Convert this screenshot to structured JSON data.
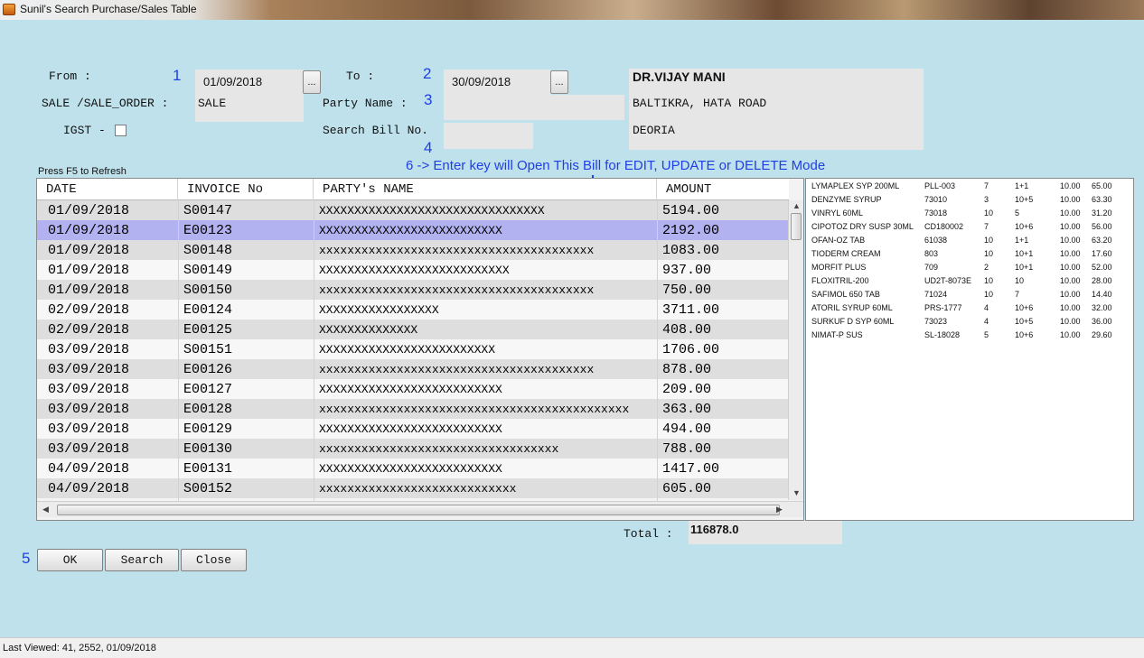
{
  "window": {
    "title": "Sunil's Search Purchase/Sales Table"
  },
  "filters": {
    "from_label": "From :",
    "from_value": "01/09/2018",
    "to_label": "To :",
    "to_value": "30/09/2018",
    "picker_label": "...",
    "sale_label": "SALE /SALE_ORDER :",
    "sale_value": "SALE",
    "party_label": "Party Name :",
    "party_value": "",
    "igst_label": "IGST -",
    "search_bill_label": "Search Bill No.",
    "search_bill_value": ""
  },
  "address": {
    "name": "DR.VIJAY MANI",
    "line1": "BALTIKRA, HATA ROAD",
    "line2": "DEORIA"
  },
  "markers": {
    "m1": "1",
    "m2": "2",
    "m3": "3",
    "m4": "4",
    "m5": "5",
    "note": "6 -> Enter key will Open This Bill for EDIT, UPDATE or DELETE Mode"
  },
  "hint": "Press F5 to Refresh",
  "grid": {
    "headers": {
      "date": "DATE",
      "invoice": "INVOICE No",
      "party": "PARTY's NAME",
      "amount": "AMOUNT"
    },
    "selected_index": 1,
    "rows": [
      {
        "date": "01/09/2018",
        "invoice": "S00147",
        "party": "XXXXXXXXXXXXXXXXXXXXXXXXXXXXXXXX",
        "amount": "5194.00"
      },
      {
        "date": "01/09/2018",
        "invoice": "E00123",
        "party": "XXXXXXXXXXXXXXXXXXXXXXXXXX",
        "amount": "2192.00"
      },
      {
        "date": "01/09/2018",
        "invoice": "S00148",
        "party": "xxxxxxxxxxxxxxxxxxxxxxxxxxxxxxxxxxxxxxx",
        "amount": "1083.00"
      },
      {
        "date": "01/09/2018",
        "invoice": "S00149",
        "party": "XXXXXXXXXXXXXXXXXXXXXXXXXXX",
        "amount": "937.00"
      },
      {
        "date": "01/09/2018",
        "invoice": "S00150",
        "party": "xxxxxxxxxxxxxxxxxxxxxxxxxxxxxxxxxxxxxxx",
        "amount": "750.00"
      },
      {
        "date": "02/09/2018",
        "invoice": "E00124",
        "party": "XXXXXXXXXXXXXXXXX",
        "amount": "3711.00"
      },
      {
        "date": "02/09/2018",
        "invoice": "E00125",
        "party": "XXXXXXXXXXXXXX",
        "amount": "408.00"
      },
      {
        "date": "03/09/2018",
        "invoice": "S00151",
        "party": "XXXXXXXXXXXXXXXXXXXXXXXXX",
        "amount": "1706.00"
      },
      {
        "date": "03/09/2018",
        "invoice": "E00126",
        "party": "xxxxxxxxxxxxxxxxxxxxxxxxxxxxxxxxxxxxxxx",
        "amount": "878.00"
      },
      {
        "date": "03/09/2018",
        "invoice": "E00127",
        "party": "XXXXXXXXXXXXXXXXXXXXXXXXXX",
        "amount": "209.00"
      },
      {
        "date": "03/09/2018",
        "invoice": "E00128",
        "party": "xxxxxxxxxxxxxxxxxxxxxxxxxxxxxxxxxxxxxxxxxxxx",
        "amount": "363.00"
      },
      {
        "date": "03/09/2018",
        "invoice": "E00129",
        "party": "XXXXXXXXXXXXXXXXXXXXXXXXXX",
        "amount": "494.00"
      },
      {
        "date": "03/09/2018",
        "invoice": "E00130",
        "party": "xxxxxxxxxxxxxxxxxxxxxxxxxxxxxxxxxx",
        "amount": "788.00"
      },
      {
        "date": "04/09/2018",
        "invoice": "E00131",
        "party": "XXXXXXXXXXXXXXXXXXXXXXXXXX",
        "amount": "1417.00"
      },
      {
        "date": "04/09/2018",
        "invoice": "S00152",
        "party": "xxxxxxxxxxxxxxxxxxxxxxxxxxxx",
        "amount": "605.00"
      }
    ]
  },
  "items": [
    {
      "name": "LYMAPLEX SYP 200ML",
      "batch": "PLL-003",
      "qty": "7",
      "scheme": "1+1",
      "gst": "10.00",
      "amount": "65.00"
    },
    {
      "name": "DENZYME SYRUP",
      "batch": "73010",
      "qty": "3",
      "scheme": "10+5",
      "gst": "10.00",
      "amount": "63.30"
    },
    {
      "name": "VINRYL 60ML",
      "batch": "73018",
      "qty": "10",
      "scheme": "5",
      "gst": "10.00",
      "amount": "31.20"
    },
    {
      "name": "CIPOTOZ DRY SUSP 30ML",
      "batch": "CD180002",
      "qty": "7",
      "scheme": "10+6",
      "gst": "10.00",
      "amount": "56.00"
    },
    {
      "name": "OFAN-OZ TAB",
      "batch": "61038",
      "qty": "10",
      "scheme": "1+1",
      "gst": "10.00",
      "amount": "63.20"
    },
    {
      "name": "TIODERM CREAM",
      "batch": "803",
      "qty": "10",
      "scheme": "10+1",
      "gst": "10.00",
      "amount": "17.60"
    },
    {
      "name": "MORFIT PLUS",
      "batch": "709",
      "qty": "2",
      "scheme": "10+1",
      "gst": "10.00",
      "amount": "52.00"
    },
    {
      "name": "FLOXITRIL-200",
      "batch": "UD2T-8073E",
      "qty": "10",
      "scheme": "10",
      "gst": "10.00",
      "amount": "28.00"
    },
    {
      "name": "SAFIMOL 650 TAB",
      "batch": "71024",
      "qty": "10",
      "scheme": "7",
      "gst": "10.00",
      "amount": "14.40"
    },
    {
      "name": "ATORIL SYRUP 60ML",
      "batch": "PRS-1777",
      "qty": "4",
      "scheme": "10+6",
      "gst": "10.00",
      "amount": "32.00"
    },
    {
      "name": "SURKUF D SYP 60ML",
      "batch": "73023",
      "qty": "4",
      "scheme": "10+5",
      "gst": "10.00",
      "amount": "36.00"
    },
    {
      "name": "NIMAT-P SUS",
      "batch": "SL-18028",
      "qty": "5",
      "scheme": "10+6",
      "gst": "10.00",
      "amount": "29.60"
    }
  ],
  "total": {
    "label": "Total :",
    "value": "116878.0"
  },
  "buttons": {
    "ok": "OK",
    "search": "Search",
    "close": "Close"
  },
  "status": "Last Viewed:  41, 2552, 01/09/2018",
  "colors": {
    "background": "#bfe1ec",
    "selected_row": "#b2b2f0",
    "marker": "#1f3fe6"
  },
  "icons": {
    "app": "app-icon",
    "arrow": "down-arrow-icon",
    "checkbox": "checkbox-icon"
  }
}
